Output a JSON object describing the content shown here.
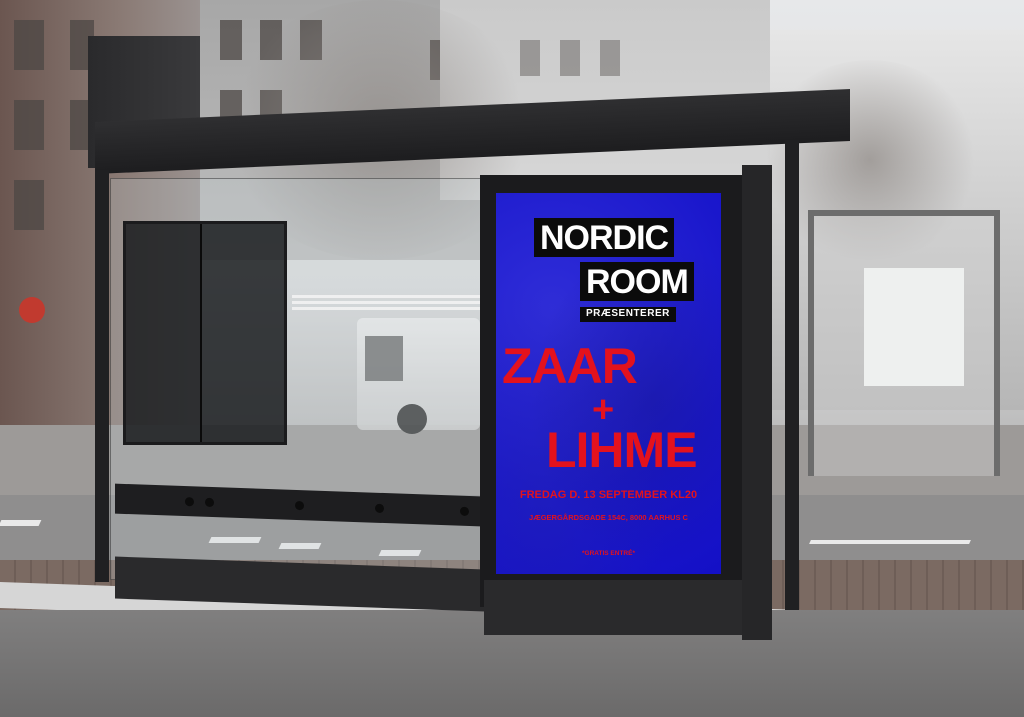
{
  "poster": {
    "brand_line_1": "NORDIC",
    "brand_line_2": "ROOM",
    "presents": "PRÆSENTERER",
    "artist_1": "ZAAR",
    "plus": "+",
    "artist_2": "LIHME",
    "date_time": "FREDAG D. 13 SEPTEMBER KL20",
    "address": "JÆGERGÅRDSGADE 154C, 8000 AARHUS C",
    "note": "*GRATIS ENTRÉ*",
    "colors": {
      "background": "#1a17cc",
      "accent_red": "#e3121d",
      "brand_box": "#0b0b0b",
      "brand_text": "#ffffff"
    }
  },
  "scene": {
    "shelter_color": "#202022",
    "sky_color": "#e7e8ea"
  }
}
